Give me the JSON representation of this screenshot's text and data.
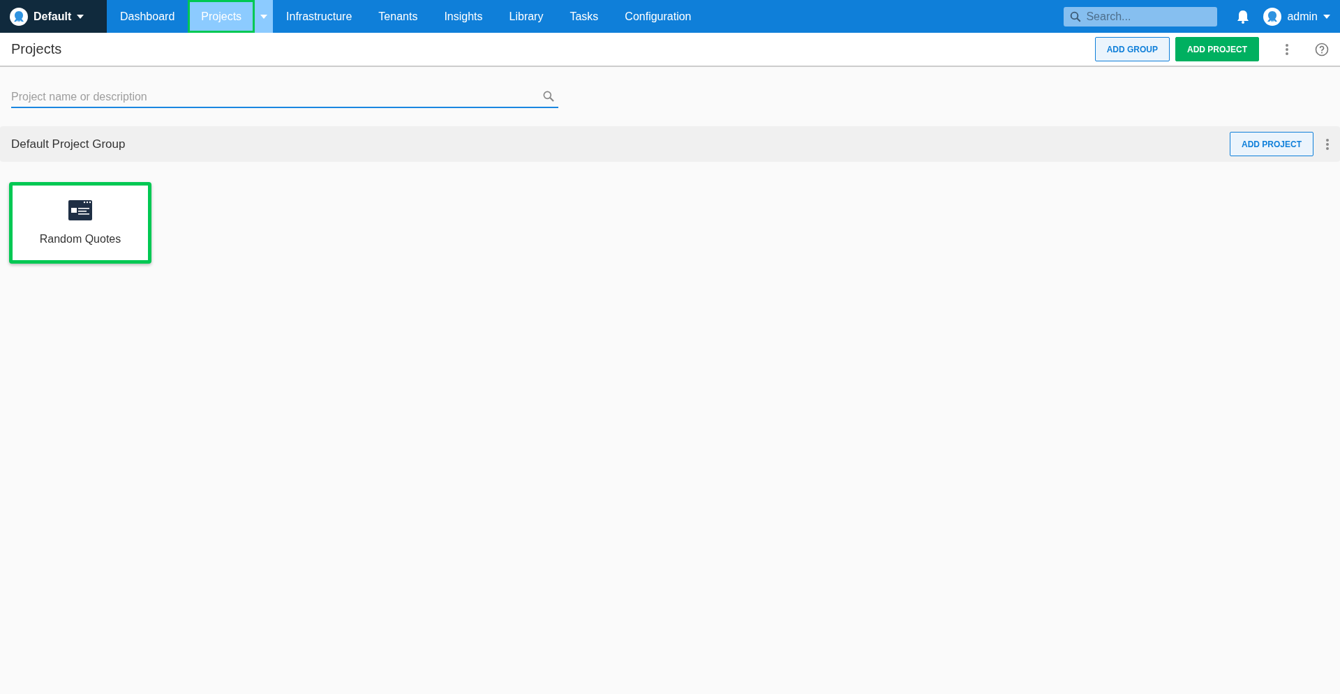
{
  "workspace": {
    "label": "Default"
  },
  "nav": [
    {
      "label": "Dashboard",
      "selected": false,
      "highlighted": false,
      "dropdown": false
    },
    {
      "label": "Projects",
      "selected": true,
      "highlighted": true,
      "dropdown": true
    },
    {
      "label": "Infrastructure",
      "selected": false,
      "highlighted": false,
      "dropdown": false
    },
    {
      "label": "Tenants",
      "selected": false,
      "highlighted": false,
      "dropdown": false
    },
    {
      "label": "Insights",
      "selected": false,
      "highlighted": false,
      "dropdown": false
    },
    {
      "label": "Library",
      "selected": false,
      "highlighted": false,
      "dropdown": false
    },
    {
      "label": "Tasks",
      "selected": false,
      "highlighted": false,
      "dropdown": false
    },
    {
      "label": "Configuration",
      "selected": false,
      "highlighted": false,
      "dropdown": false
    }
  ],
  "search": {
    "placeholder": "Search..."
  },
  "user": {
    "name": "admin"
  },
  "page": {
    "title": "Projects",
    "buttons": [
      {
        "label": "ADD GROUP",
        "kind": "outline"
      },
      {
        "label": "ADD PROJECT",
        "kind": "primary"
      }
    ]
  },
  "filter": {
    "placeholder": "Project name or description"
  },
  "groups": [
    {
      "name": "Default Project Group",
      "button": "ADD PROJECT",
      "projects": [
        {
          "name": "Random Quotes",
          "highlighted": true
        }
      ]
    }
  ]
}
